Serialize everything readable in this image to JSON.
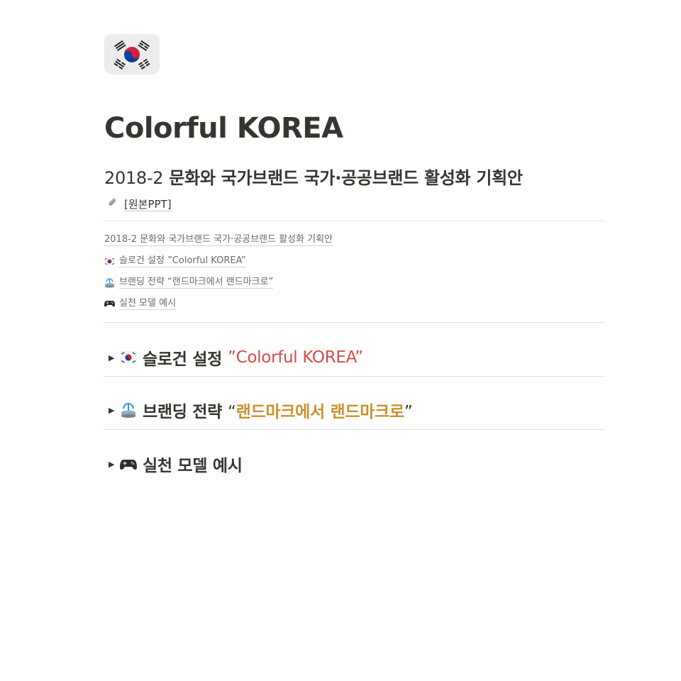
{
  "page": {
    "icon": "south-korea-flag-icon",
    "title": "Colorful KOREA",
    "subtitle_number": "2018-2",
    "subtitle_text": "문화와 국가브랜드 국가·공공브랜드 활성화 기획안",
    "attachment": {
      "icon": "paperclip-icon",
      "label": "[원본PPT]"
    }
  },
  "toc": [
    {
      "icon": "",
      "label": "2018-2 문화와 국가브랜드 국가·공공브랜드 활성화 기획안"
    },
    {
      "icon": "south-korea-flag-icon",
      "label": "슬로건 설정 ”Colorful KOREA”"
    },
    {
      "icon": "fountain-icon",
      "label": "브랜딩 전략 “랜드마크에서 랜드마크로”"
    },
    {
      "icon": "game-controller-icon",
      "label": "실천 모델 예시"
    }
  ],
  "sections": [
    {
      "icon": "south-korea-flag-icon",
      "label": "슬로건 설정",
      "quote_open": "”",
      "highlight": "Colorful KOREA",
      "quote_close": "”",
      "highlight_color": "#d44c47"
    },
    {
      "icon": "fountain-icon",
      "label": "브랜딩 전략",
      "quote_open": "“",
      "highlight": "랜드마크에서 랜드마크로",
      "quote_close": "”",
      "highlight_color": "#cb912f"
    },
    {
      "icon": "game-controller-icon",
      "label": "실천 모델 예시"
    }
  ],
  "colors": {
    "text": "#37352f",
    "muted": "#6b6a66",
    "red": "#d44c47",
    "gold": "#cb912f",
    "divider": "#e3e2e0"
  }
}
